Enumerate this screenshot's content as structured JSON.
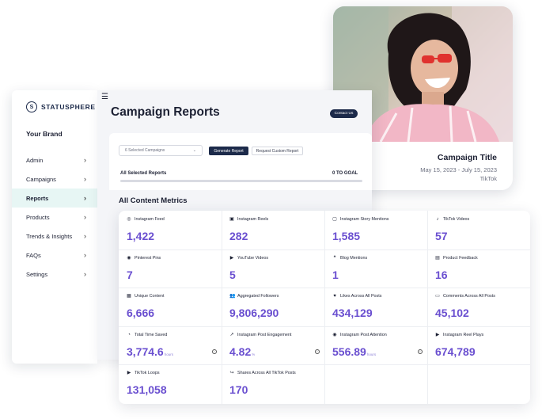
{
  "campaign_card": {
    "title": "Campaign Title",
    "dates": "May 15, 2023 - July 15, 2023",
    "platform": "TikTok"
  },
  "sidebar": {
    "logo_text": "STATUSPHERE",
    "logo_mark": "S",
    "brand": "Your Brand",
    "items": [
      {
        "label": "Admin",
        "chevron": "›"
      },
      {
        "label": "Campaigns",
        "chevron": "›"
      },
      {
        "label": "Reports",
        "chevron": "›"
      },
      {
        "label": "Products",
        "chevron": "›"
      },
      {
        "label": "Trends & Insights",
        "chevron": "›"
      },
      {
        "label": "FAQs",
        "chevron": "›"
      },
      {
        "label": "Settings",
        "chevron": "›"
      }
    ],
    "active_index": 2
  },
  "header": {
    "menu_icon": "☰",
    "title": "Campaign Reports",
    "contact_label": "Contact Us"
  },
  "filters": {
    "select_value": "6 Selected Campaigns",
    "select_arrow": "⌄",
    "generate_label": "Generate Report",
    "request_label": "Request Custom Report",
    "selected_label": "All Selected Reports",
    "goal_label": "0 TO GOAL",
    "progress_fraction": 0
  },
  "metrics": {
    "title": "All Content Metrics",
    "items": [
      {
        "label": "Instagram Feed",
        "value": "1,422",
        "icon": "instagram-icon",
        "glyph": "◎",
        "unit": "",
        "info": false
      },
      {
        "label": "Instagram Reels",
        "value": "282",
        "icon": "reels-icon",
        "glyph": "▣",
        "unit": "",
        "info": false
      },
      {
        "label": "Instagram Story Mentions",
        "value": "1,585",
        "icon": "story-icon",
        "glyph": "▢",
        "unit": "",
        "info": false
      },
      {
        "label": "TikTok Videos",
        "value": "57",
        "icon": "tiktok-icon",
        "glyph": "♪",
        "unit": "",
        "info": false
      },
      {
        "label": "Pinterest Pins",
        "value": "7",
        "icon": "pinterest-icon",
        "glyph": "◉",
        "unit": "",
        "info": false
      },
      {
        "label": "YouTube Videos",
        "value": "5",
        "icon": "youtube-icon",
        "glyph": "▶",
        "unit": "",
        "info": false
      },
      {
        "label": "Blog Mentions",
        "value": "1",
        "icon": "blog-icon",
        "glyph": "❝",
        "unit": "",
        "info": false
      },
      {
        "label": "Product Feedback",
        "value": "16",
        "icon": "feedback-icon",
        "glyph": "▤",
        "unit": "",
        "info": false
      },
      {
        "label": "Unique Content",
        "value": "6,666",
        "icon": "content-icon",
        "glyph": "▦",
        "unit": "",
        "info": false
      },
      {
        "label": "Aggregated Followers",
        "value": "9,806,290",
        "icon": "followers-icon",
        "glyph": "👥",
        "unit": "",
        "info": false
      },
      {
        "label": "Likes Across All Posts",
        "value": "434,129",
        "icon": "heart-icon",
        "glyph": "♥",
        "unit": "",
        "info": false
      },
      {
        "label": "Comments Across All Posts",
        "value": "45,102",
        "icon": "comment-icon",
        "glyph": "▭",
        "unit": "",
        "info": false
      },
      {
        "label": "Total Time Saved",
        "value": "3,774.6",
        "icon": "time-icon",
        "glyph": "◔",
        "unit": "hours",
        "info": true
      },
      {
        "label": "Instagram Post Engagement",
        "value": "4.82",
        "icon": "engagement-icon",
        "glyph": "↗",
        "unit": "%",
        "info": true
      },
      {
        "label": "Instagram Post Attention",
        "value": "556.89",
        "icon": "eye-icon",
        "glyph": "◉",
        "unit": "hours",
        "info": true
      },
      {
        "label": "Instagram Reel Plays",
        "value": "674,789",
        "icon": "play-icon",
        "glyph": "▶",
        "unit": "",
        "info": false
      },
      {
        "label": "TikTok Loops",
        "value": "131,058",
        "icon": "loop-icon",
        "glyph": "▶",
        "unit": "",
        "info": false
      },
      {
        "label": "Shares Across All TikTok Posts",
        "value": "170",
        "icon": "share-icon",
        "glyph": "↪",
        "unit": "",
        "info": false
      }
    ]
  },
  "colors": {
    "accent": "#6a4fd0",
    "navy": "#1c2a4a",
    "active_bg": "#e7f6f4"
  }
}
